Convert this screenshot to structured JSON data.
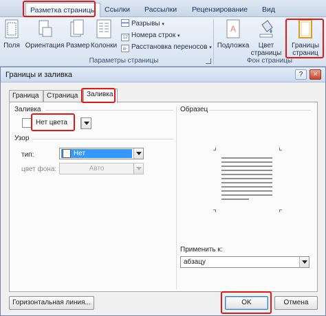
{
  "ribbon": {
    "tabs": [
      "Разметка страницы",
      "Ссылки",
      "Рассылки",
      "Рецензирование",
      "Вид"
    ],
    "buttons": {
      "margins": "Поля",
      "orientation": "Ориентация",
      "size": "Размер",
      "columns": "Колонки",
      "breaks": "Разрывы",
      "line_numbers": "Номера строк",
      "hyphenation": "Расстановка переносов",
      "watermark": "Подложка",
      "page_color_1": "Цвет",
      "page_color_2": "страницы",
      "page_borders_1": "Границы",
      "page_borders_2": "страниц"
    },
    "groups": {
      "page_setup": "Параметры страницы",
      "page_background": "Фон страницы"
    }
  },
  "dialog": {
    "title": "Границы и заливка",
    "help": "?",
    "close": "×",
    "tabs": [
      "Граница",
      "Страница",
      "Заливка"
    ],
    "fill_section": "Заливка",
    "fill_value": "Нет цвета",
    "pattern_section": "Узор",
    "type_label": "тип:",
    "type_value": "Нет",
    "bg_color_label": "цвет фона:",
    "bg_color_value": "Авто",
    "preview_section": "Образец",
    "apply_to_label": "Применить к:",
    "apply_to_value": "абзацу",
    "horizontal_line_button": "Горизонтальная линия...",
    "ok_button": "OK",
    "cancel_button": "Отмена"
  },
  "colors": {
    "highlight_frame": "#e01818",
    "selection": "#3399ff"
  }
}
